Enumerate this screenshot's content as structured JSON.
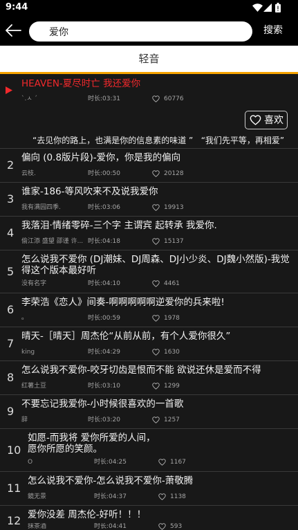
{
  "status_bar": {
    "time": "9:44",
    "icons": [
      "wifi-icon",
      "signal-icon",
      "battery-icon"
    ]
  },
  "header": {
    "back_icon": "back-arrow-icon",
    "search_value": "爱你",
    "search_button": "搜索"
  },
  "tabs": [
    {
      "label": "轻音",
      "active": true
    }
  ],
  "colors": {
    "accent": "#f5a300",
    "playing": "#f2292c",
    "background": "#181818",
    "bar": "#000000"
  },
  "now_playing": {
    "icon": "play-icon",
    "title": "HEAVEN-夏尽时亡 我还爱你",
    "artist": "ˋ.ㅅ ˊ",
    "duration": "时长:03:31",
    "likes": "60776",
    "like_icon": "heart-outline-icon",
    "like_button": "喜欢",
    "lyric": "“去见你的路上，也满是你的信息素的味道 ”   “我们先平等，再相爱”"
  },
  "songs": [
    {
      "rank": "2",
      "title": "偏向 (0.8版片段)-爱你，你是我的偏向",
      "artist": "云枝.",
      "duration": "时长:00:50",
      "likes": "20128"
    },
    {
      "rank": "3",
      "title": "谁家-186-等风吹来不及说我爱你",
      "artist": "我有满园四季.",
      "duration": "时长:03:06",
      "likes": "19913"
    },
    {
      "rank": "4",
      "title": "我落泪·情绪零碎-三个字 主谓宾 起转承 我爱你.",
      "artist": "偷江添 盛望 邵谨 许...",
      "duration": "时长:04:18",
      "likes": "15137"
    },
    {
      "rank": "5",
      "title": "怎么说我不爱你 (DJ潮妹、DJ周森、DJ小少炎、DJ魏小然版)-我觉得这个版本最好听",
      "artist": "没有名字",
      "duration": "时长:04:10",
      "likes": "4461"
    },
    {
      "rank": "6",
      "title": "李荣浩《恋人》间奏-啊啊啊啊啊逆爱你的兵来啦!",
      "artist": "ₒ",
      "duration": "时长:00:59",
      "likes": "1978"
    },
    {
      "rank": "7",
      "title": "晴天-［晴天］周杰伦“从前从前，有个人爱你很久”",
      "artist": "king",
      "duration": "时长:04:29",
      "likes": "1630"
    },
    {
      "rank": "8",
      "title": "怎么说我不爱你-咬牙切齿是恨而不能 欲说还休是爱而不得",
      "artist": "红薯土豆",
      "duration": "时长:03:10",
      "likes": "1299"
    },
    {
      "rank": "9",
      "title": "不要忘记我爱你-小时候很喜欢的一首歌",
      "artist": "辞",
      "duration": "时长:03:20",
      "likes": "1257"
    },
    {
      "rank": "10",
      "title": "如愿-而我将 爱你所爱的人间，\n愿你所愿的笑颜。",
      "artist": "O",
      "duration": "时长:04:25",
      "likes": "1167"
    },
    {
      "rank": "11",
      "title": "怎么说我不爱你-怎么说我不爱你-萧敬腾",
      "artist": "鏡无景",
      "duration": "时长:04:37",
      "likes": "1138"
    },
    {
      "rank": "12",
      "title": "爱你没差 周杰伦-好听！！！",
      "artist": "抹茶酒",
      "duration": "时长:04:41",
      "likes": "593"
    }
  ]
}
